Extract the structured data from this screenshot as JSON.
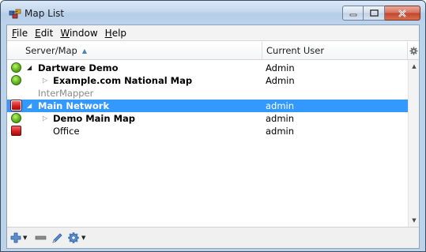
{
  "window": {
    "title": "Map List",
    "caption_buttons": [
      "minimize",
      "maximize",
      "close"
    ]
  },
  "menubar": {
    "items": [
      {
        "label": "File",
        "mnemonic": "F",
        "rest": "ile"
      },
      {
        "label": "Edit",
        "mnemonic": "E",
        "rest": "dit"
      },
      {
        "label": "Window",
        "mnemonic": "W",
        "rest": "indow"
      },
      {
        "label": "Help",
        "mnemonic": "H",
        "rest": "elp"
      }
    ]
  },
  "table": {
    "columns": {
      "server_map": "Server/Map",
      "current_user": "Current User"
    },
    "sort": {
      "column": "server_map",
      "direction": "ascending"
    },
    "rows": [
      {
        "status": "green",
        "expander": "open",
        "name": "Dartware Demo",
        "user": "Admin",
        "bold": true,
        "selected": false
      },
      {
        "status": "green",
        "expander": "closed",
        "name": "Example.com National Map",
        "user": "Admin",
        "bold": true,
        "selected": false
      },
      {
        "status": "none",
        "expander": "none",
        "name": "InterMapper",
        "user": "",
        "bold": false,
        "selected": false
      },
      {
        "status": "red",
        "expander": "open",
        "name": "Main Network",
        "user": "admin",
        "bold": true,
        "selected": true
      },
      {
        "status": "green",
        "expander": "closed",
        "name": "Demo Main Map",
        "user": "admin",
        "bold": true,
        "selected": false
      },
      {
        "status": "red",
        "expander": "none",
        "name": "Office",
        "user": "admin",
        "bold": false,
        "selected": false
      }
    ]
  },
  "toolbar": {
    "buttons": [
      "add-icon",
      "remove-icon",
      "edit-icon",
      "settings-icon"
    ]
  },
  "colors": {
    "selection": "#3399ff",
    "status_green": "#6ec021",
    "status_red": "#d21c1c",
    "title_bar": "#bcd3ea"
  }
}
